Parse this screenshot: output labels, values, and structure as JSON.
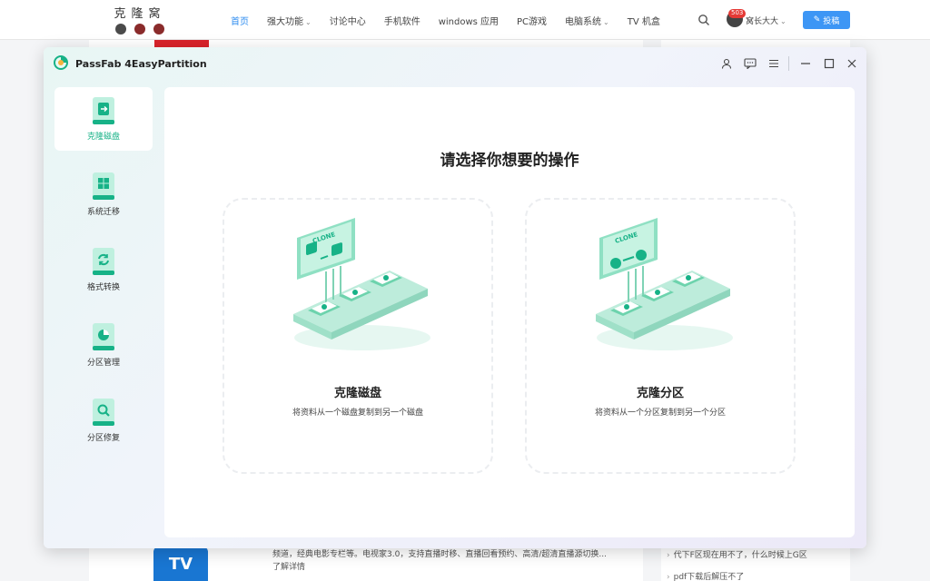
{
  "site": {
    "logo_text": "克隆窝",
    "nav": [
      {
        "label": "首页",
        "active": true,
        "dropdown": false
      },
      {
        "label": "强大功能",
        "active": false,
        "dropdown": true
      },
      {
        "label": "讨论中心",
        "active": false,
        "dropdown": false
      },
      {
        "label": "手机软件",
        "active": false,
        "dropdown": false
      },
      {
        "label": "windows 应用",
        "active": false,
        "dropdown": false
      },
      {
        "label": "PC游戏",
        "active": false,
        "dropdown": false
      },
      {
        "label": "电脑系统",
        "active": false,
        "dropdown": true
      },
      {
        "label": "TV 机盒",
        "active": false,
        "dropdown": false
      }
    ],
    "notification_count": "503",
    "user_name": "窝长大大",
    "post_button": "投稿",
    "tv_logo": "TV",
    "tv_text_1": "频道，经典电影专栏等。电视家3.0，支持直播时移、直播回看预约、高清/超清直播源切换...",
    "tv_text_2": "了解详情",
    "right_items": [
      "代下F区现在用不了，什么时候上G区",
      "pdf下载后解压不了"
    ]
  },
  "app": {
    "title": "PassFab 4EasyPartition",
    "colors": {
      "accent": "#17b287",
      "accent_light": "#bff0df",
      "window_tint": "#e8f6f4"
    },
    "titlebar_icons": [
      "user-icon",
      "feedback-icon",
      "menu-icon",
      "minimize-icon",
      "maximize-icon",
      "close-icon"
    ],
    "sidebar": [
      {
        "label": "克隆磁盘",
        "icon": "clone-disk-icon",
        "active": true
      },
      {
        "label": "系统迁移",
        "icon": "system-migration-icon",
        "active": false
      },
      {
        "label": "格式转换",
        "icon": "format-convert-icon",
        "active": false
      },
      {
        "label": "分区管理",
        "icon": "partition-manage-icon",
        "active": false
      },
      {
        "label": "分区修复",
        "icon": "partition-repair-icon",
        "active": false
      }
    ],
    "main": {
      "title": "请选择你想要的操作",
      "options": [
        {
          "title": "克隆磁盘",
          "desc": "将资料从一个磁盘复制到另一个磁盘",
          "illus_label": "CLONE"
        },
        {
          "title": "克隆分区",
          "desc": "将资料从一个分区复制到另一个分区",
          "illus_label": "CLONE"
        }
      ]
    }
  }
}
